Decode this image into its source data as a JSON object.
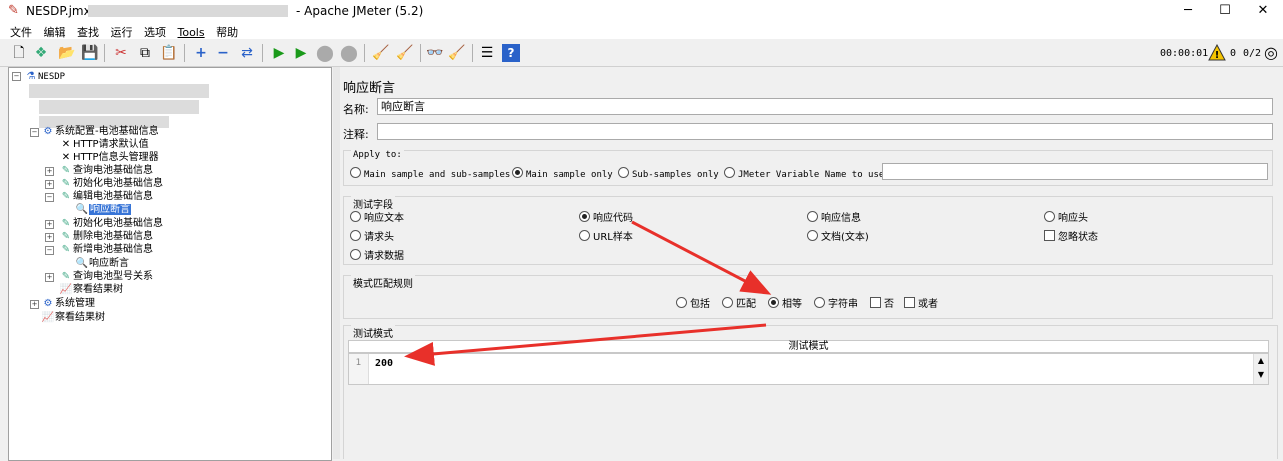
{
  "window": {
    "title_prefix": "NESDP.jmx",
    "title_suffix": "- Apache JMeter (5.2)"
  },
  "menu": [
    "文件",
    "编辑",
    "查找",
    "运行",
    "选项",
    "Tools",
    "帮助"
  ],
  "status": {
    "timer": "00:00:01",
    "warnings": "0",
    "threads": "0/2"
  },
  "tree": {
    "root": "NESDP",
    "config_group": "系统配置-电池基础信息",
    "items": [
      "HTTP请求默认值",
      "HTTP信息头管理器",
      "查询电池基础信息",
      "初始化电池基础信息",
      "编辑电池基础信息",
      "响应断言",
      "初始化电池基础信息",
      "删除电池基础信息",
      "新增电池基础信息",
      "响应断言",
      "查询电池型号关系",
      "察看结果树",
      "系统管理",
      "察看结果树"
    ]
  },
  "assertion": {
    "heading": "响应断言",
    "name_label": "名称:",
    "name_value": "响应断言",
    "comment_label": "注释:",
    "comment_value": "",
    "apply_to": {
      "title": "Apply to:",
      "options": [
        "Main sample and sub-samples",
        "Main sample only",
        "Sub-samples only",
        "JMeter Variable Name to use"
      ],
      "selected": "Main sample only",
      "variable_value": ""
    },
    "field_to_test": {
      "title": "测试字段",
      "options": [
        "响应文本",
        "响应代码",
        "响应信息",
        "响应头",
        "请求头",
        "URL样本",
        "文档(文本)",
        "请求数据"
      ],
      "ignore_status": "忽略状态",
      "selected": "响应代码"
    },
    "matching_rules": {
      "title": "模式匹配规则",
      "options": [
        "包括",
        "匹配",
        "相等",
        "字符串"
      ],
      "not_label": "否",
      "or_label": "或者",
      "selected": "相等"
    },
    "patterns": {
      "title": "测试模式",
      "column": "测试模式",
      "line_number": "1",
      "value": "200"
    }
  },
  "colors": {
    "accent": "#3875d7",
    "arrow": "#e8302a"
  }
}
